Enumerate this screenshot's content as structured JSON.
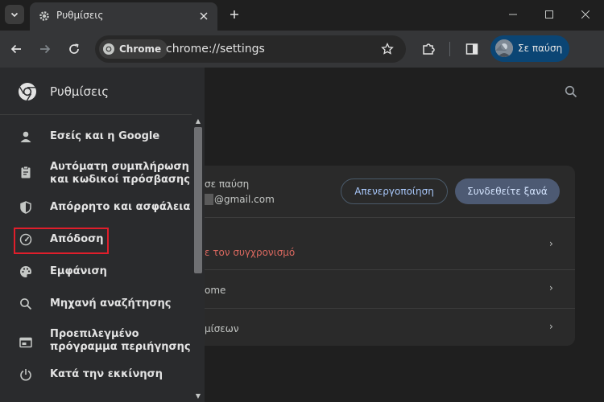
{
  "tab": {
    "title": "Ρυθμίσεις"
  },
  "omnibox": {
    "chip_label": "Chrome",
    "url": "chrome://settings"
  },
  "profile": {
    "label": "Σε παύση"
  },
  "sidebar": {
    "title": "Ρυθμίσεις",
    "items": [
      {
        "label": "Εσείς και η Google",
        "icon": "person-icon"
      },
      {
        "label": "Αυτόματη συμπλήρωση\nκαι κωδικοί πρόσβασης",
        "icon": "clipboard-icon"
      },
      {
        "label": "Απόρρητο και ασφάλεια",
        "icon": "shield-icon"
      },
      {
        "label": "Απόδοση",
        "icon": "speedometer-icon"
      },
      {
        "label": "Εμφάνιση",
        "icon": "palette-icon"
      },
      {
        "label": "Μηχανή αναζήτησης",
        "icon": "search-icon"
      },
      {
        "label": "Προεπιλεγμένο\nπρόγραμμα περιήγησης",
        "icon": "browser-icon"
      },
      {
        "label": "Κατά την εκκίνηση",
        "icon": "power-icon"
      }
    ]
  },
  "content": {
    "paused_text": "σε παύση",
    "email": "@gmail.com",
    "disable_button": "Απενεργοποίηση",
    "signin_button": "Συνδεθείτε ξανά",
    "rows": [
      {
        "text": "ε τον συγχρονισμό"
      },
      {
        "text": "ome"
      },
      {
        "text": "μίσεων"
      }
    ]
  },
  "colors": {
    "accent": "#a8c7fa",
    "highlight_border": "#e01e2b",
    "sync_error_text": "#d9685f",
    "profile_bg": "#0b4574"
  }
}
